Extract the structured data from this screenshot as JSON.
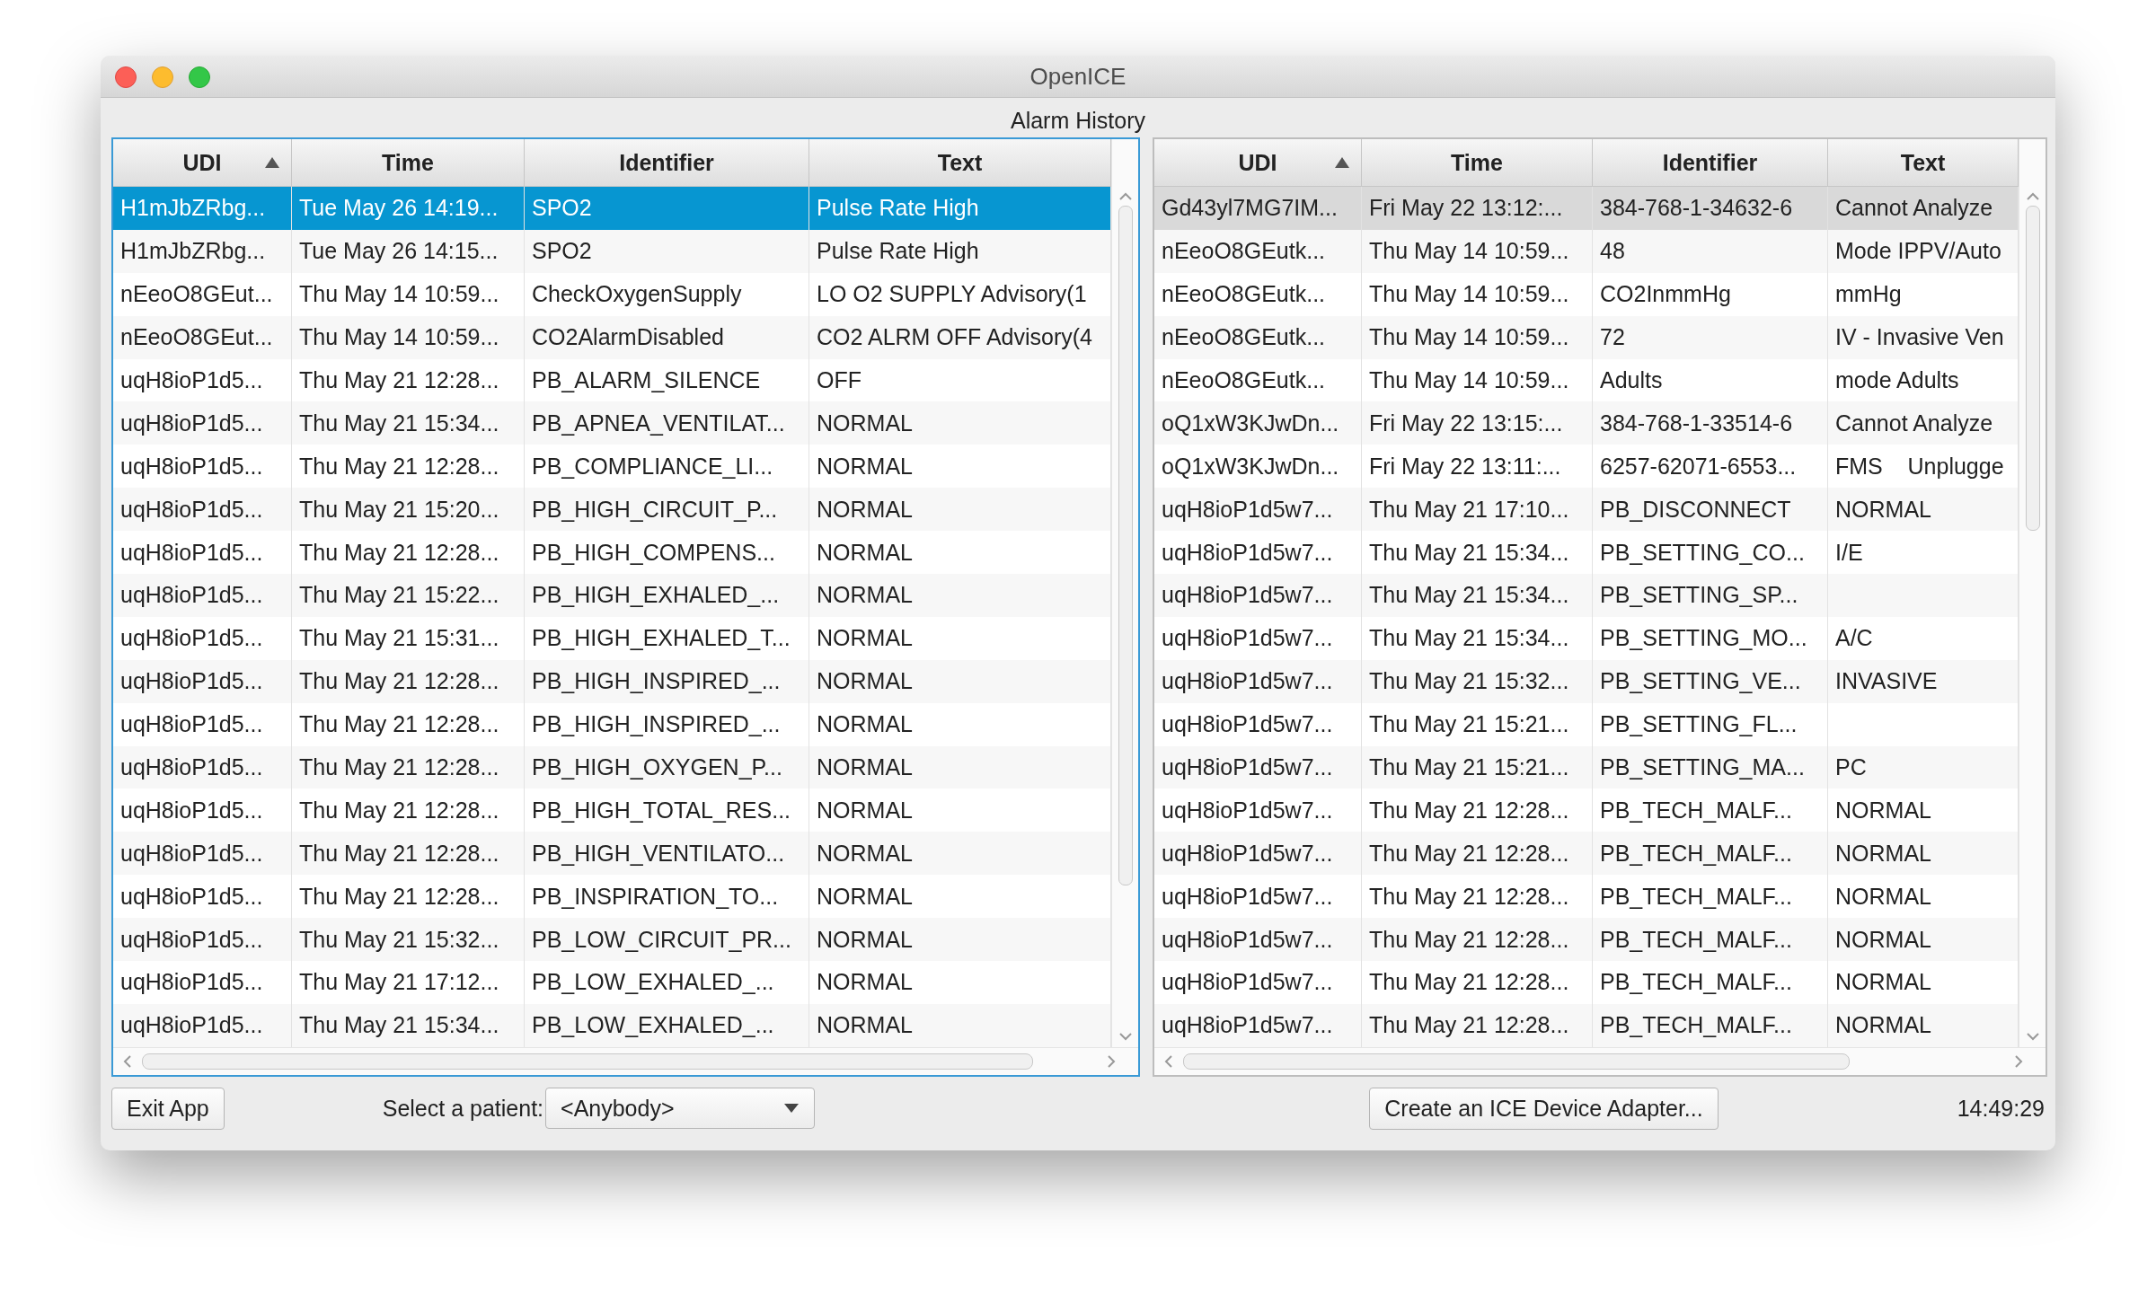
{
  "window": {
    "title": "OpenICE"
  },
  "heading": "Alarm History",
  "tables": [
    {
      "focused": true,
      "columns": [
        {
          "label": "UDI",
          "sorted": true
        },
        {
          "label": "Time",
          "sorted": false
        },
        {
          "label": "Identifier",
          "sorted": false
        },
        {
          "label": "Text",
          "sorted": false
        }
      ],
      "rows": [
        {
          "selected": true,
          "cells": [
            "H1mJbZRbg...",
            "Tue May 26 14:19...",
            "SPO2",
            "Pulse Rate High"
          ]
        },
        {
          "selected": false,
          "cells": [
            "H1mJbZRbg...",
            "Tue May 26 14:15...",
            "SPO2",
            "Pulse Rate High"
          ]
        },
        {
          "selected": false,
          "cells": [
            "nEeoO8GEut...",
            "Thu May 14 10:59...",
            "CheckOxygenSupply",
            "LO O2 SUPPLY Advisory(1"
          ]
        },
        {
          "selected": false,
          "cells": [
            "nEeoO8GEut...",
            "Thu May 14 10:59...",
            "CO2AlarmDisabled",
            "CO2 ALRM OFF Advisory(4"
          ]
        },
        {
          "selected": false,
          "cells": [
            "uqH8ioP1d5...",
            "Thu May 21 12:28...",
            "PB_ALARM_SILENCE",
            "OFF"
          ]
        },
        {
          "selected": false,
          "cells": [
            "uqH8ioP1d5...",
            "Thu May 21 15:34...",
            "PB_APNEA_VENTILAT...",
            "NORMAL"
          ]
        },
        {
          "selected": false,
          "cells": [
            "uqH8ioP1d5...",
            "Thu May 21 12:28...",
            "PB_COMPLIANCE_LI...",
            "NORMAL"
          ]
        },
        {
          "selected": false,
          "cells": [
            "uqH8ioP1d5...",
            "Thu May 21 15:20...",
            "PB_HIGH_CIRCUIT_P...",
            "NORMAL"
          ]
        },
        {
          "selected": false,
          "cells": [
            "uqH8ioP1d5...",
            "Thu May 21 12:28...",
            "PB_HIGH_COMPENS...",
            "NORMAL"
          ]
        },
        {
          "selected": false,
          "cells": [
            "uqH8ioP1d5...",
            "Thu May 21 15:22...",
            "PB_HIGH_EXHALED_...",
            "NORMAL"
          ]
        },
        {
          "selected": false,
          "cells": [
            "uqH8ioP1d5...",
            "Thu May 21 15:31...",
            "PB_HIGH_EXHALED_T...",
            "NORMAL"
          ]
        },
        {
          "selected": false,
          "cells": [
            "uqH8ioP1d5...",
            "Thu May 21 12:28...",
            "PB_HIGH_INSPIRED_...",
            "NORMAL"
          ]
        },
        {
          "selected": false,
          "cells": [
            "uqH8ioP1d5...",
            "Thu May 21 12:28...",
            "PB_HIGH_INSPIRED_...",
            "NORMAL"
          ]
        },
        {
          "selected": false,
          "cells": [
            "uqH8ioP1d5...",
            "Thu May 21 12:28...",
            "PB_HIGH_OXYGEN_P...",
            "NORMAL"
          ]
        },
        {
          "selected": false,
          "cells": [
            "uqH8ioP1d5...",
            "Thu May 21 12:28...",
            "PB_HIGH_TOTAL_RES...",
            "NORMAL"
          ]
        },
        {
          "selected": false,
          "cells": [
            "uqH8ioP1d5...",
            "Thu May 21 12:28...",
            "PB_HIGH_VENTILATO...",
            "NORMAL"
          ]
        },
        {
          "selected": false,
          "cells": [
            "uqH8ioP1d5...",
            "Thu May 21 12:28...",
            "PB_INSPIRATION_TO...",
            "NORMAL"
          ]
        },
        {
          "selected": false,
          "cells": [
            "uqH8ioP1d5...",
            "Thu May 21 15:32...",
            "PB_LOW_CIRCUIT_PR...",
            "NORMAL"
          ]
        },
        {
          "selected": false,
          "cells": [
            "uqH8ioP1d5...",
            "Thu May 21 17:12...",
            "PB_LOW_EXHALED_...",
            "NORMAL"
          ]
        },
        {
          "selected": false,
          "cells": [
            "uqH8ioP1d5...",
            "Thu May 21 15:34...",
            "PB_LOW_EXHALED_...",
            "NORMAL"
          ]
        }
      ]
    },
    {
      "focused": false,
      "columns": [
        {
          "label": "UDI",
          "sorted": true
        },
        {
          "label": "Time",
          "sorted": false
        },
        {
          "label": "Identifier",
          "sorted": false
        },
        {
          "label": "Text",
          "sorted": false
        }
      ],
      "rows": [
        {
          "selected": true,
          "cells": [
            "Gd43yl7MG7IM...",
            "Fri May 22 13:12:...",
            "384-768-1-34632-6",
            "Cannot Analyze"
          ]
        },
        {
          "selected": false,
          "cells": [
            "nEeoO8GEutk...",
            "Thu May 14 10:59...",
            "48",
            "Mode IPPV/Auto"
          ]
        },
        {
          "selected": false,
          "cells": [
            "nEeoO8GEutk...",
            "Thu May 14 10:59...",
            "CO2InmmHg",
            "mmHg"
          ]
        },
        {
          "selected": false,
          "cells": [
            "nEeoO8GEutk...",
            "Thu May 14 10:59...",
            "72",
            "IV - Invasive Ven"
          ]
        },
        {
          "selected": false,
          "cells": [
            "nEeoO8GEutk...",
            "Thu May 14 10:59...",
            "Adults",
            "mode Adults"
          ]
        },
        {
          "selected": false,
          "cells": [
            "oQ1xW3KJwDn...",
            "Fri May 22 13:15:...",
            "384-768-1-33514-6",
            "Cannot Analyze"
          ]
        },
        {
          "selected": false,
          "cells": [
            "oQ1xW3KJwDn...",
            "Fri May 22 13:11:...",
            "6257-62071-6553...",
            "FMS    Unplugge"
          ]
        },
        {
          "selected": false,
          "cells": [
            "uqH8ioP1d5w7...",
            "Thu May 21 17:10...",
            "PB_DISCONNECT",
            "NORMAL"
          ]
        },
        {
          "selected": false,
          "cells": [
            "uqH8ioP1d5w7...",
            "Thu May 21 15:34...",
            "PB_SETTING_CO...",
            "I/E"
          ]
        },
        {
          "selected": false,
          "cells": [
            "uqH8ioP1d5w7...",
            "Thu May 21 15:34...",
            "PB_SETTING_SP...",
            ""
          ]
        },
        {
          "selected": false,
          "cells": [
            "uqH8ioP1d5w7...",
            "Thu May 21 15:34...",
            "PB_SETTING_MO...",
            "A/C"
          ]
        },
        {
          "selected": false,
          "cells": [
            "uqH8ioP1d5w7...",
            "Thu May 21 15:32...",
            "PB_SETTING_VE...",
            "INVASIVE"
          ]
        },
        {
          "selected": false,
          "cells": [
            "uqH8ioP1d5w7...",
            "Thu May 21 15:21...",
            "PB_SETTING_FL...",
            ""
          ]
        },
        {
          "selected": false,
          "cells": [
            "uqH8ioP1d5w7...",
            "Thu May 21 15:21...",
            "PB_SETTING_MA...",
            "PC"
          ]
        },
        {
          "selected": false,
          "cells": [
            "uqH8ioP1d5w7...",
            "Thu May 21 12:28...",
            "PB_TECH_MALF...",
            "NORMAL"
          ]
        },
        {
          "selected": false,
          "cells": [
            "uqH8ioP1d5w7...",
            "Thu May 21 12:28...",
            "PB_TECH_MALF...",
            "NORMAL"
          ]
        },
        {
          "selected": false,
          "cells": [
            "uqH8ioP1d5w7...",
            "Thu May 21 12:28...",
            "PB_TECH_MALF...",
            "NORMAL"
          ]
        },
        {
          "selected": false,
          "cells": [
            "uqH8ioP1d5w7...",
            "Thu May 21 12:28...",
            "PB_TECH_MALF...",
            "NORMAL"
          ]
        },
        {
          "selected": false,
          "cells": [
            "uqH8ioP1d5w7...",
            "Thu May 21 12:28...",
            "PB_TECH_MALF...",
            "NORMAL"
          ]
        },
        {
          "selected": false,
          "cells": [
            "uqH8ioP1d5w7...",
            "Thu May 21 12:28...",
            "PB_TECH_MALF...",
            "NORMAL"
          ]
        }
      ]
    }
  ],
  "exit_button": "Exit App",
  "patient_select": {
    "label": "Select a patient:",
    "value": "<Anybody>"
  },
  "create_button": "Create an ICE Device Adapter...",
  "clock": "14:49:29"
}
